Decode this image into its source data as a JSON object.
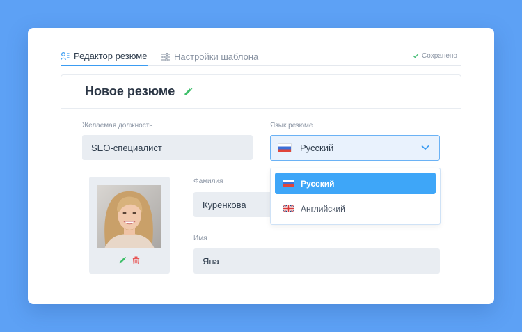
{
  "tabs": [
    {
      "label": "Редактор резюме",
      "icon": "user-list-icon",
      "active": true
    },
    {
      "label": "Настройки шаблона",
      "icon": "sliders-icon",
      "active": false
    }
  ],
  "status": {
    "saved_label": "Сохранено",
    "icon": "check-icon"
  },
  "resume": {
    "title": "Новое резюме",
    "edit_icon": "pencil-icon"
  },
  "form": {
    "position": {
      "label": "Желаемая должность",
      "value": "SEO-специалист"
    },
    "language": {
      "label": "Язык резюме",
      "value": "Русский"
    },
    "last_name": {
      "label": "Фамилия",
      "value": "Куренкова"
    },
    "first_name": {
      "label": "Имя",
      "value": "Яна"
    }
  },
  "language_dropdown": {
    "options": [
      {
        "label": "Русский",
        "flag": "russia-flag-icon",
        "selected": true
      },
      {
        "label": "Английский",
        "flag": "uk-flag-icon",
        "selected": false
      }
    ]
  },
  "photo": {
    "edit_icon": "pencil-icon",
    "delete_icon": "trash-icon"
  },
  "colors": {
    "background": "#5da1f5",
    "accent": "#3ea6f8",
    "edit_green": "#3fbf6a",
    "delete_red": "#e85656"
  }
}
